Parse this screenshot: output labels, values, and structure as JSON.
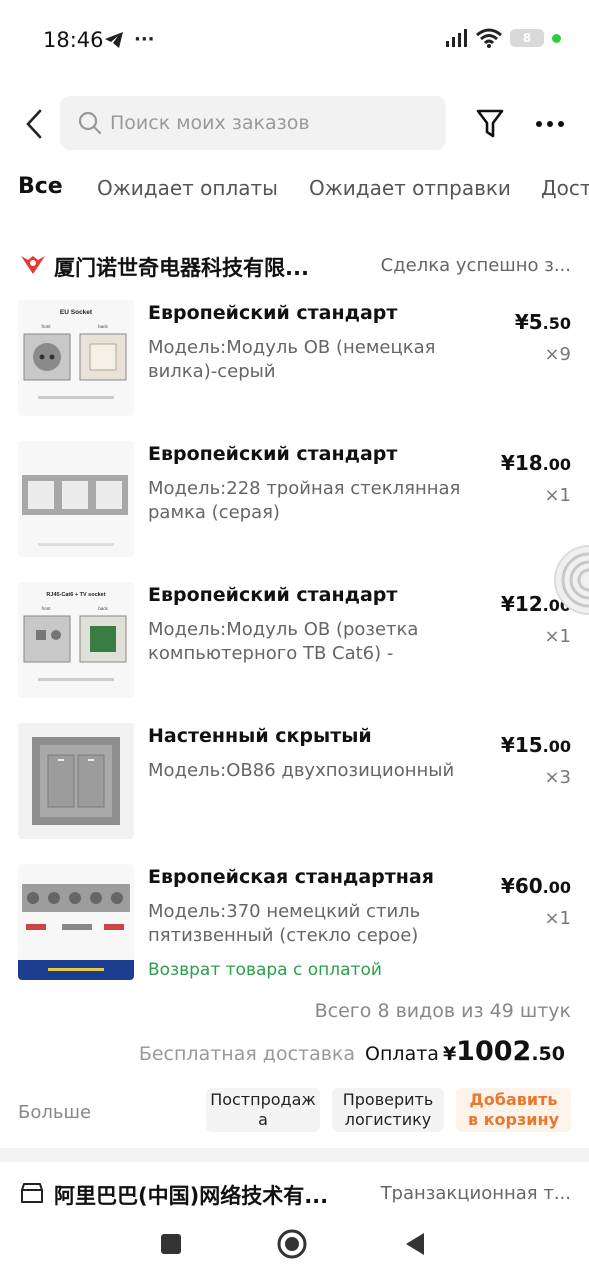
{
  "status_bar": {
    "time": "18:46",
    "dots": "···",
    "battery": "8"
  },
  "header": {
    "search_placeholder": "Поиск моих заказов"
  },
  "tabs": [
    "Все",
    "Ожидает оплаты",
    "Ожидает отправки",
    "Дост"
  ],
  "order1": {
    "seller": "厦门诺世奇电器科技有限...",
    "status": "Сделка успешно з...",
    "items": [
      {
        "title": "Европейский стандарт",
        "model": "Модель:Модуль OB (немецкая вилка)-серый",
        "price_int": "¥5",
        "price_dec": ".50",
        "qty": "×9",
        "thumb_labels": [
          "EU Socket",
          "front",
          "back"
        ]
      },
      {
        "title": "Европейский стандарт",
        "model": "Модель:228 тройная стеклянная рамка (серая)",
        "price_int": "¥18",
        "price_dec": ".00",
        "qty": "×1"
      },
      {
        "title": "Европейский стандарт",
        "model": "Модель:Модуль OB (розетка компьютерного ТВ Cat6) -",
        "price_int": "¥12",
        "price_dec": ".00",
        "qty": "×1",
        "thumb_labels": [
          "RJ45-Cat6 + TV socket",
          "front",
          "back"
        ]
      },
      {
        "title": "Настенный скрытый",
        "model": "Модель:OB86 двухпозиционный",
        "price_int": "¥15",
        "price_dec": ".00",
        "qty": "×3"
      },
      {
        "title": "Европейская стандартная",
        "model": "Модель:370 немецкий стиль пятизвенный (стекло серое)",
        "price_int": "¥60",
        "price_dec": ".00",
        "qty": "×1",
        "extra": "Возврат товара с оплатой"
      }
    ],
    "total_line": "Всего 8 видов из 49 штук",
    "free_shipping": "Бесплатная доставка",
    "payment_label": "Оплата",
    "payment_yen": "¥",
    "payment_int": "1002",
    "payment_dec": ".50",
    "more": "Больше",
    "buttons": {
      "after_sale": "Постпродаж а",
      "logistics": "Проверить логистику",
      "add_cart": "Добавить в корзину"
    }
  },
  "order2": {
    "seller": "阿里巴巴(中国)网络技术有...",
    "status": "Транзакционная т..."
  },
  "colors": {
    "accent_orange": "#e9782f",
    "green": "#2aa04a",
    "logo_red": "#e33b2e"
  }
}
